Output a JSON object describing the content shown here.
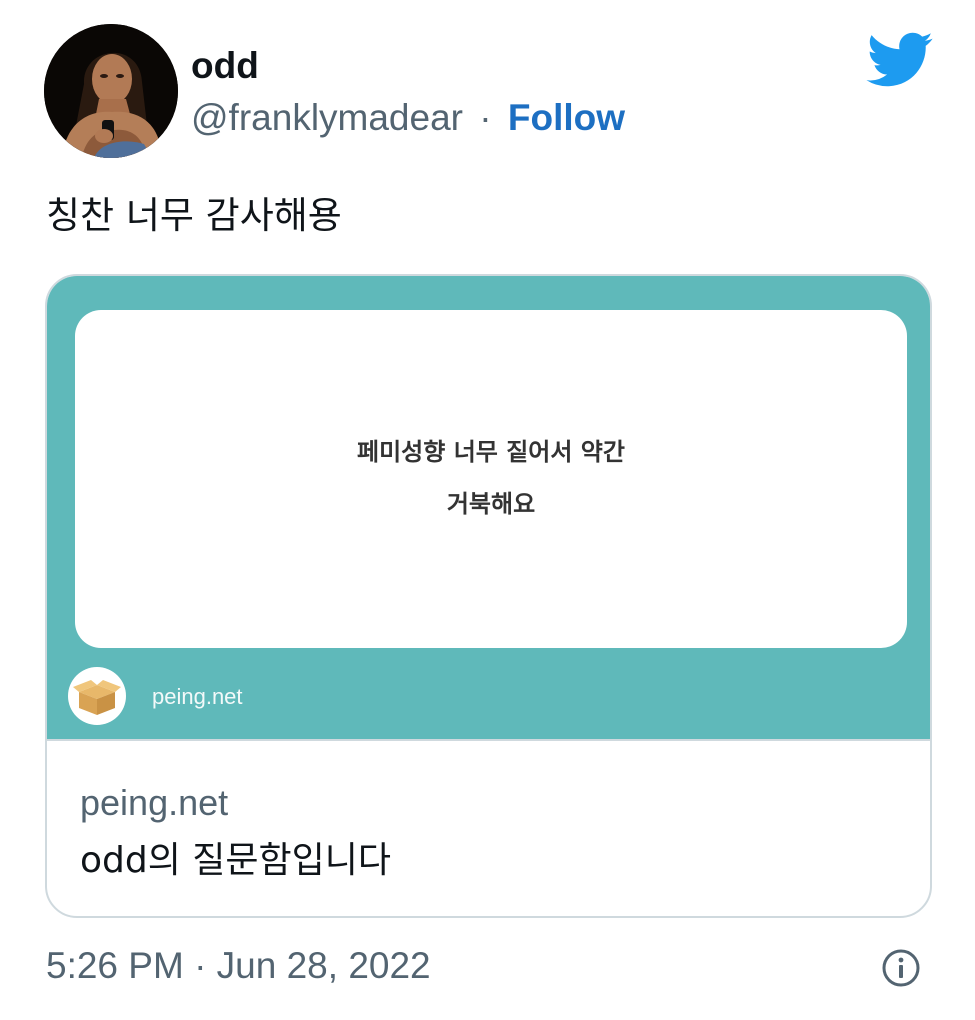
{
  "author": {
    "display_name": "odd",
    "handle": "@franklymadear",
    "separator": "·",
    "follow_label": "Follow",
    "avatar_icon": "profile-photo"
  },
  "brand": {
    "logo_icon": "twitter-bird-icon",
    "color": "#1d9bf0"
  },
  "tweet": {
    "text": "칭찬 너무 감사해용"
  },
  "card": {
    "media": {
      "background_color": "#5fb9ba",
      "question_line_1": "페미성향 너무 짙어서 약간",
      "question_line_2": "거북해요",
      "site_label": "peing.net",
      "site_logo_icon": "cardboard-box-icon"
    },
    "domain": "peing.net",
    "title": "odd의 질문함입니다"
  },
  "footer": {
    "timestamp": "5:26 PM · Jun 28, 2022",
    "info_icon": "info-icon"
  },
  "colors": {
    "follow_link": "#1d6fc2",
    "secondary_text": "#536471",
    "border": "#cfd9de"
  }
}
